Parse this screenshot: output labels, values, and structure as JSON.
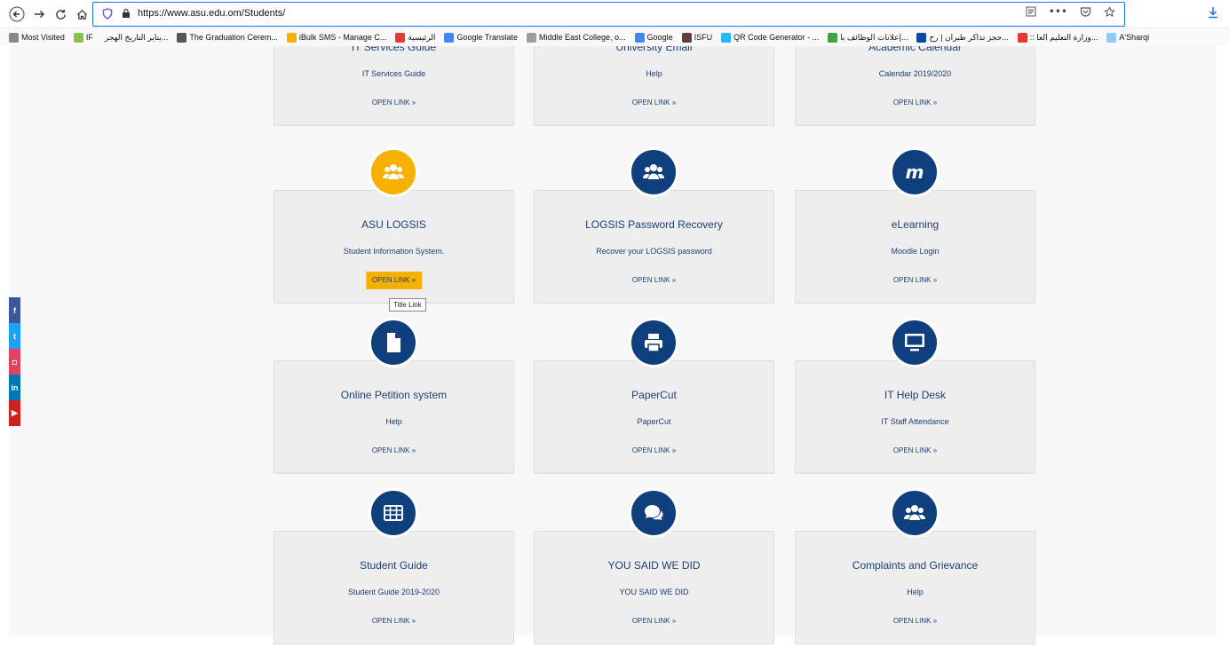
{
  "browser": {
    "url": "https://www.asu.edu.om/Students/",
    "bookmarks": [
      {
        "label": "Most Visited",
        "color": "#888888"
      },
      {
        "label": "IF",
        "color": "#8bc34a"
      },
      {
        "label": "يناير التاريخ الهجر...",
        "color": "#ffffff"
      },
      {
        "label": "The Graduation Cerem...",
        "color": "#555555"
      },
      {
        "label": "iBulk SMS - Manage C...",
        "color": "#f5b000"
      },
      {
        "label": "الرئيسية",
        "color": "#e53935"
      },
      {
        "label": "Google Translate",
        "color": "#4285f4"
      },
      {
        "label": "Middle East College, o...",
        "color": "#9e9e9e"
      },
      {
        "label": "Google",
        "color": "#4285f4"
      },
      {
        "label": "ISFU",
        "color": "#5d4037"
      },
      {
        "label": "QR Code Generator - ...",
        "color": "#29b6f6"
      },
      {
        "label": "إعلانات الوظائف با...",
        "color": "#43a047"
      },
      {
        "label": "حجز تذاكر طيران | رح...",
        "color": "#0d47a1"
      },
      {
        "label": ":: وزارة التعليم العا...",
        "color": "#e53935"
      },
      {
        "label": "A'Sharqi",
        "color": "#90caf9"
      }
    ]
  },
  "colors": {
    "navy": "#0f3f7d",
    "accent": "#f5b000",
    "text": "#1c3f72"
  },
  "cards": [
    {
      "title": "IT Services Guide",
      "sub": "IT Services Guide",
      "link": "OPEN LINK »",
      "icon": "",
      "active": false
    },
    {
      "title": "University Email",
      "sub": "Help",
      "link": "OPEN LINK »",
      "icon": "",
      "active": false
    },
    {
      "title": "Academic Calendar",
      "sub": "Calendar 2019/2020",
      "link": "OPEN LINK »",
      "icon": "",
      "active": false
    },
    {
      "title": "ASU LOGSIS",
      "sub": "Student Information System.",
      "link": "OPEN LINK »",
      "icon": "users-icon",
      "active": true
    },
    {
      "title": "LOGSIS Password Recovery",
      "sub": "Recover your LOGSIS password",
      "link": "OPEN LINK »",
      "icon": "users-icon",
      "active": false
    },
    {
      "title": "eLearning",
      "sub": "Moodle Login",
      "link": "OPEN LINK »",
      "icon": "moodle-icon",
      "active": false
    },
    {
      "title": "Online Petition system",
      "sub": "Help",
      "link": "OPEN LINK »",
      "icon": "file-icon",
      "active": false
    },
    {
      "title": "PaperCut",
      "sub": "PaperCut",
      "link": "OPEN LINK »",
      "icon": "printer-icon",
      "active": false
    },
    {
      "title": "IT Help Desk",
      "sub": "IT Staff Attendance",
      "link": "OPEN LINK »",
      "icon": "monitor-icon",
      "active": false
    },
    {
      "title": "Student Guide",
      "sub": "Student Guide 2019-2020",
      "link": "OPEN LINK »",
      "icon": "table-icon",
      "active": false
    },
    {
      "title": "YOU SAID WE DID",
      "sub": "YOU SAID WE DID",
      "link": "OPEN LINK »",
      "icon": "chat-icon",
      "active": false
    },
    {
      "title": "Complaints and Grievance",
      "sub": "Help",
      "link": "OPEN LINK »",
      "icon": "users-icon",
      "active": false
    }
  ],
  "tooltip": "Title Link",
  "social": [
    {
      "label": "f",
      "icon": "facebook-icon",
      "color": "#3b5998"
    },
    {
      "label": "t",
      "icon": "twitter-icon",
      "color": "#1da1f2"
    },
    {
      "label": "◘",
      "icon": "instagram-icon",
      "color": "#e4405f"
    },
    {
      "label": "in",
      "icon": "linkedin-icon",
      "color": "#0077b5"
    },
    {
      "label": "▶",
      "icon": "youtube-icon",
      "color": "#cd201f"
    }
  ]
}
